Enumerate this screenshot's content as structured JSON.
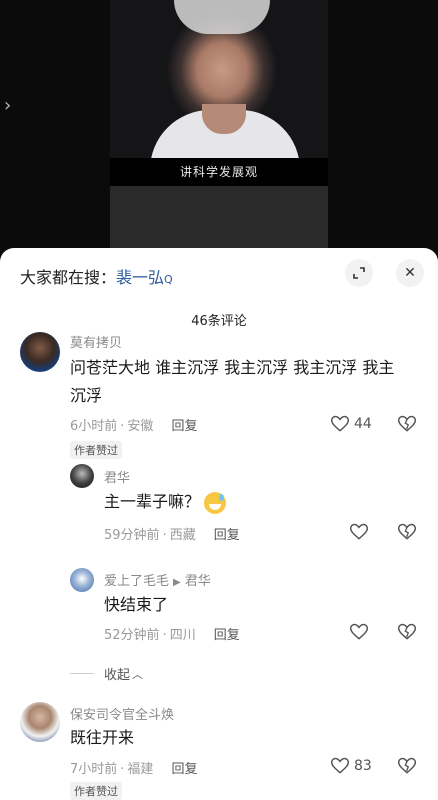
{
  "video": {
    "subtitle": "讲科学发展观"
  },
  "sheet": {
    "search_prefix": "大家都在搜：",
    "search_term": "裴一弘",
    "comment_count": "46条评论"
  },
  "comments": [
    {
      "username": "莫有拷贝",
      "text_line1": "问苍茫大地 谁主沉浮 我主沉浮 我主沉浮 我主",
      "text_line2": "沉浮",
      "time": "6小时前",
      "location": "安徽",
      "reply_label": "回复",
      "likes": "44",
      "badge": "作者赞过"
    },
    {
      "username": "君华",
      "text": "主一辈子嘛？",
      "time": "59分钟前",
      "location": "西藏",
      "reply_label": "回复"
    },
    {
      "username": "爱上了毛毛",
      "reply_to": "君华",
      "text": "快结束了",
      "time": "52分钟前",
      "location": "四川",
      "reply_label": "回复"
    },
    {
      "username": "保安司令官全斗焕",
      "text": "既往开来",
      "time": "7小时前",
      "location": "福建",
      "reply_label": "回复",
      "likes": "83",
      "badge": "作者赞过"
    }
  ],
  "collapse_label": "收起",
  "icons": {
    "expand": "expand-icon",
    "close": "close-icon",
    "heart": "heart-icon",
    "dislike": "broken-heart-icon",
    "search": "search-icon",
    "chevron_up": "chevron-up-icon"
  },
  "colors": {
    "accent_link": "#2f5e9e",
    "muted_text": "#9a9a9a"
  }
}
